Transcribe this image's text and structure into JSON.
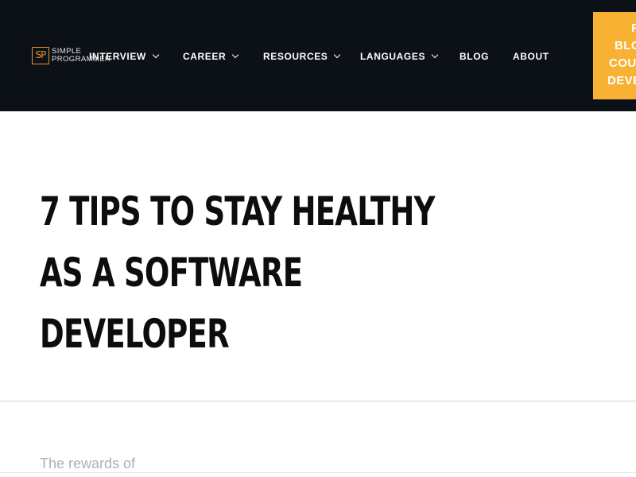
{
  "logo": {
    "mark": "SP",
    "line1": "SIMPLE",
    "line2": "PROGRAMMER"
  },
  "nav": {
    "items": [
      {
        "label": "INTERVIEW",
        "has_dropdown": true
      },
      {
        "label": "CAREER",
        "has_dropdown": true
      },
      {
        "label": "RESOURCES",
        "has_dropdown": true
      },
      {
        "label": "LANGUAGES",
        "has_dropdown": true
      },
      {
        "label": "BLOG",
        "has_dropdown": false
      },
      {
        "label": "ABOUT",
        "has_dropdown": false
      }
    ]
  },
  "cta": {
    "lines": [
      "F",
      "BLO",
      "COU",
      "DEVE"
    ]
  },
  "article": {
    "title_lines": [
      "7 TIPS TO STAY HEALTHY",
      "AS A SOFTWARE",
      "DEVELOPER"
    ],
    "excerpt": "The rewards of"
  },
  "colors": {
    "header_bg": "#0c1117",
    "accent": "#e59326",
    "cta_bg": "#f8b133",
    "title": "#0d0d0d",
    "excerpt": "#b0b0b0"
  }
}
